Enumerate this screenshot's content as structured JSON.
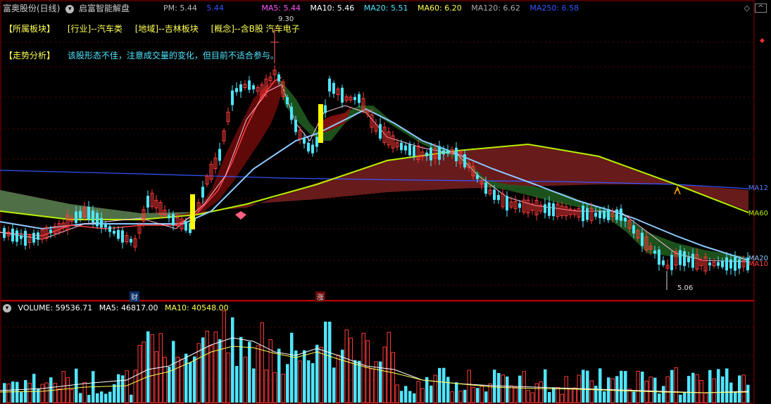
{
  "header": {
    "stock_name": "富奥股份(日线)",
    "indicator_name": "启富智能解盘",
    "pm_label": "PM: 5.44",
    "pm_value": "5.44"
  },
  "ma_legend": {
    "ma5": "MA5: 5.44",
    "ma10": "MA10: 5.46",
    "ma20": "MA20: 5.51",
    "ma60": "MA60: 6.20",
    "ma120": "MA120: 6.62",
    "ma250": "MA250: 6.58"
  },
  "sector_row": {
    "label": "【所属板块】",
    "industry": "[行业]--汽车类",
    "region": "[地域]--吉林板块",
    "concept": "[概念]--含B股  汽车电子"
  },
  "analysis_row": {
    "label": "【走势分析】",
    "text": "该股形态不佳，注意成交量的变化，但目前不适合参与。"
  },
  "annotations": {
    "high_marker": "9.30",
    "low_marker": "5.06",
    "badge_cai": "财",
    "badge_zhang": "涨"
  },
  "axis_tags": {
    "ma120": "MA12",
    "ma60": "MA60",
    "ma20": "MA20",
    "ma10": "MA10"
  },
  "volume_header": {
    "volume": "VOLUME: 59536.71",
    "ma5": "MA5: 46817.00",
    "ma10": "MA10: 40548.00"
  },
  "colors": {
    "up": "#ff3a3a",
    "down": "#4fe5ff",
    "ma5": "#ffffff",
    "ma10": "#ffff55",
    "ma20": "#ff55ff",
    "ma60": "#55ff55",
    "ma120": "#aaaaaa",
    "ma250": "#3355ff",
    "signal": "#ffff00"
  },
  "icons": [
    "chevron-down-icon",
    "diamond-icon",
    "scroll-up-icon",
    "scroll-down-icon"
  ]
}
